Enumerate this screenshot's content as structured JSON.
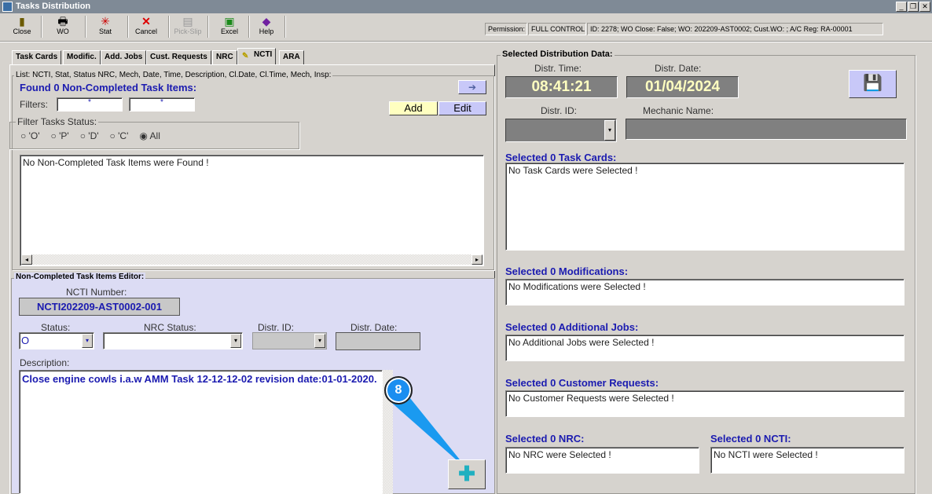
{
  "window": {
    "title": "Tasks Distribution"
  },
  "toolbar": [
    {
      "label": "Close",
      "icon": "door-exit-icon"
    },
    {
      "label": "WO",
      "icon": "printer-icon"
    },
    {
      "label": "Stat",
      "icon": "asterisk-icon"
    },
    {
      "label": "Cancel",
      "icon": "red-x-icon"
    },
    {
      "label": "Pick-Slip",
      "icon": "pick-slip-icon",
      "disabled": true
    },
    {
      "label": "Excel",
      "icon": "excel-icon"
    },
    {
      "label": "Help",
      "icon": "help-book-icon"
    }
  ],
  "info": {
    "permission_label": "Permission:",
    "permission": "FULL CONTROL",
    "details": "ID: 2278; WO Close: False; WO: 202209-AST0002; Cust.WO:  ; A/C Reg: RA-00001"
  },
  "tabs": [
    "Task Cards",
    "Modific.",
    "Add. Jobs",
    "Cust. Requests",
    "NRC",
    "NCTI",
    "ARA"
  ],
  "active_tab": "NCTI",
  "list": {
    "caption": "List: NCTI, Stat, Status NRC, Mech, Date, Time, Description, Cl.Date, Cl.Time, Mech, Insp:",
    "found": "Found 0 Non-Completed Task Items:",
    "filters_label": "Filters:",
    "filter1": "*",
    "filter2": "*",
    "add": "Add",
    "edit": "Edit",
    "status_caption": "Filter Tasks Status:",
    "radios": [
      "'O'",
      "'P'",
      "'D'",
      "'C'",
      "All"
    ],
    "selected_radio": "All",
    "empty": "No Non-Completed Task Items were Found !"
  },
  "editor": {
    "caption": "Non-Completed Task Items Editor:",
    "ncti_label": "NCTI Number:",
    "ncti": "NCTI202209-AST0002-001",
    "status_label": "Status:",
    "status": "O",
    "nrc_label": "NRC Status:",
    "nrc": "",
    "distr_id_label": "Distr. ID:",
    "distr_date_label": "Distr. Date:",
    "desc_label": "Description:",
    "description": "Close engine cowls i.a.w AMM Task 12-12-12-02 revision date:01-01-2020.",
    "callout": "8"
  },
  "dist": {
    "caption": "Selected Distribution Data:",
    "time_label": "Distr. Time:",
    "time": "08:41:21",
    "date_label": "Distr. Date:",
    "date": "01/04/2024",
    "id_label": "Distr. ID:",
    "mech_label": "Mechanic Name:",
    "task_cards": {
      "title": "Selected 0 Task Cards:",
      "empty": "No Task Cards were Selected !"
    },
    "mods": {
      "title": "Selected 0 Modifications:",
      "empty": "No Modifications were Selected !"
    },
    "jobs": {
      "title": "Selected 0 Additional Jobs:",
      "empty": "No Additional Jobs were Selected !"
    },
    "cust": {
      "title": "Selected 0 Customer Requests:",
      "empty": "No Customer Requests were Selected !"
    },
    "nrc": {
      "title": "Selected 0 NRC:",
      "empty": "No NRC were Selected !"
    },
    "ncti": {
      "title": "Selected 0 NCTI:",
      "empty": "No NCTI were Selected !"
    }
  }
}
